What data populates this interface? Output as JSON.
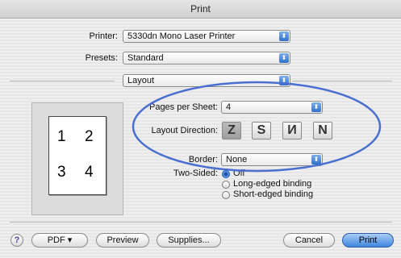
{
  "window": {
    "title": "Print"
  },
  "printer": {
    "label": "Printer:",
    "value": "5330dn Mono Laser Printer"
  },
  "presets": {
    "label": "Presets:",
    "value": "Standard"
  },
  "panel": {
    "value": "Layout"
  },
  "preview": {
    "numbers": [
      "1",
      "2",
      "3",
      "4"
    ]
  },
  "pages_per_sheet": {
    "label": "Pages per Sheet:",
    "value": "4"
  },
  "layout_direction": {
    "label": "Layout Direction:",
    "options": [
      {
        "name": "z-pattern",
        "glyph": "Z",
        "selected": true
      },
      {
        "name": "s-pattern",
        "glyph": "S",
        "selected": false
      },
      {
        "name": "n-reverse-pattern",
        "glyph": "И",
        "selected": false
      },
      {
        "name": "n-pattern",
        "glyph": "N",
        "selected": false
      }
    ]
  },
  "border": {
    "label": "Border:",
    "value": "None"
  },
  "two_sided": {
    "label": "Two-Sided:",
    "options": [
      "Off",
      "Long-edged binding",
      "Short-edged binding"
    ],
    "selected": "Off"
  },
  "buttons": {
    "help": "?",
    "pdf": "PDF ▾",
    "preview": "Preview",
    "supplies": "Supplies...",
    "cancel": "Cancel",
    "print": "Print"
  },
  "colors": {
    "highlight_ellipse": "#4a6fd0",
    "accent": "#3f86df"
  }
}
